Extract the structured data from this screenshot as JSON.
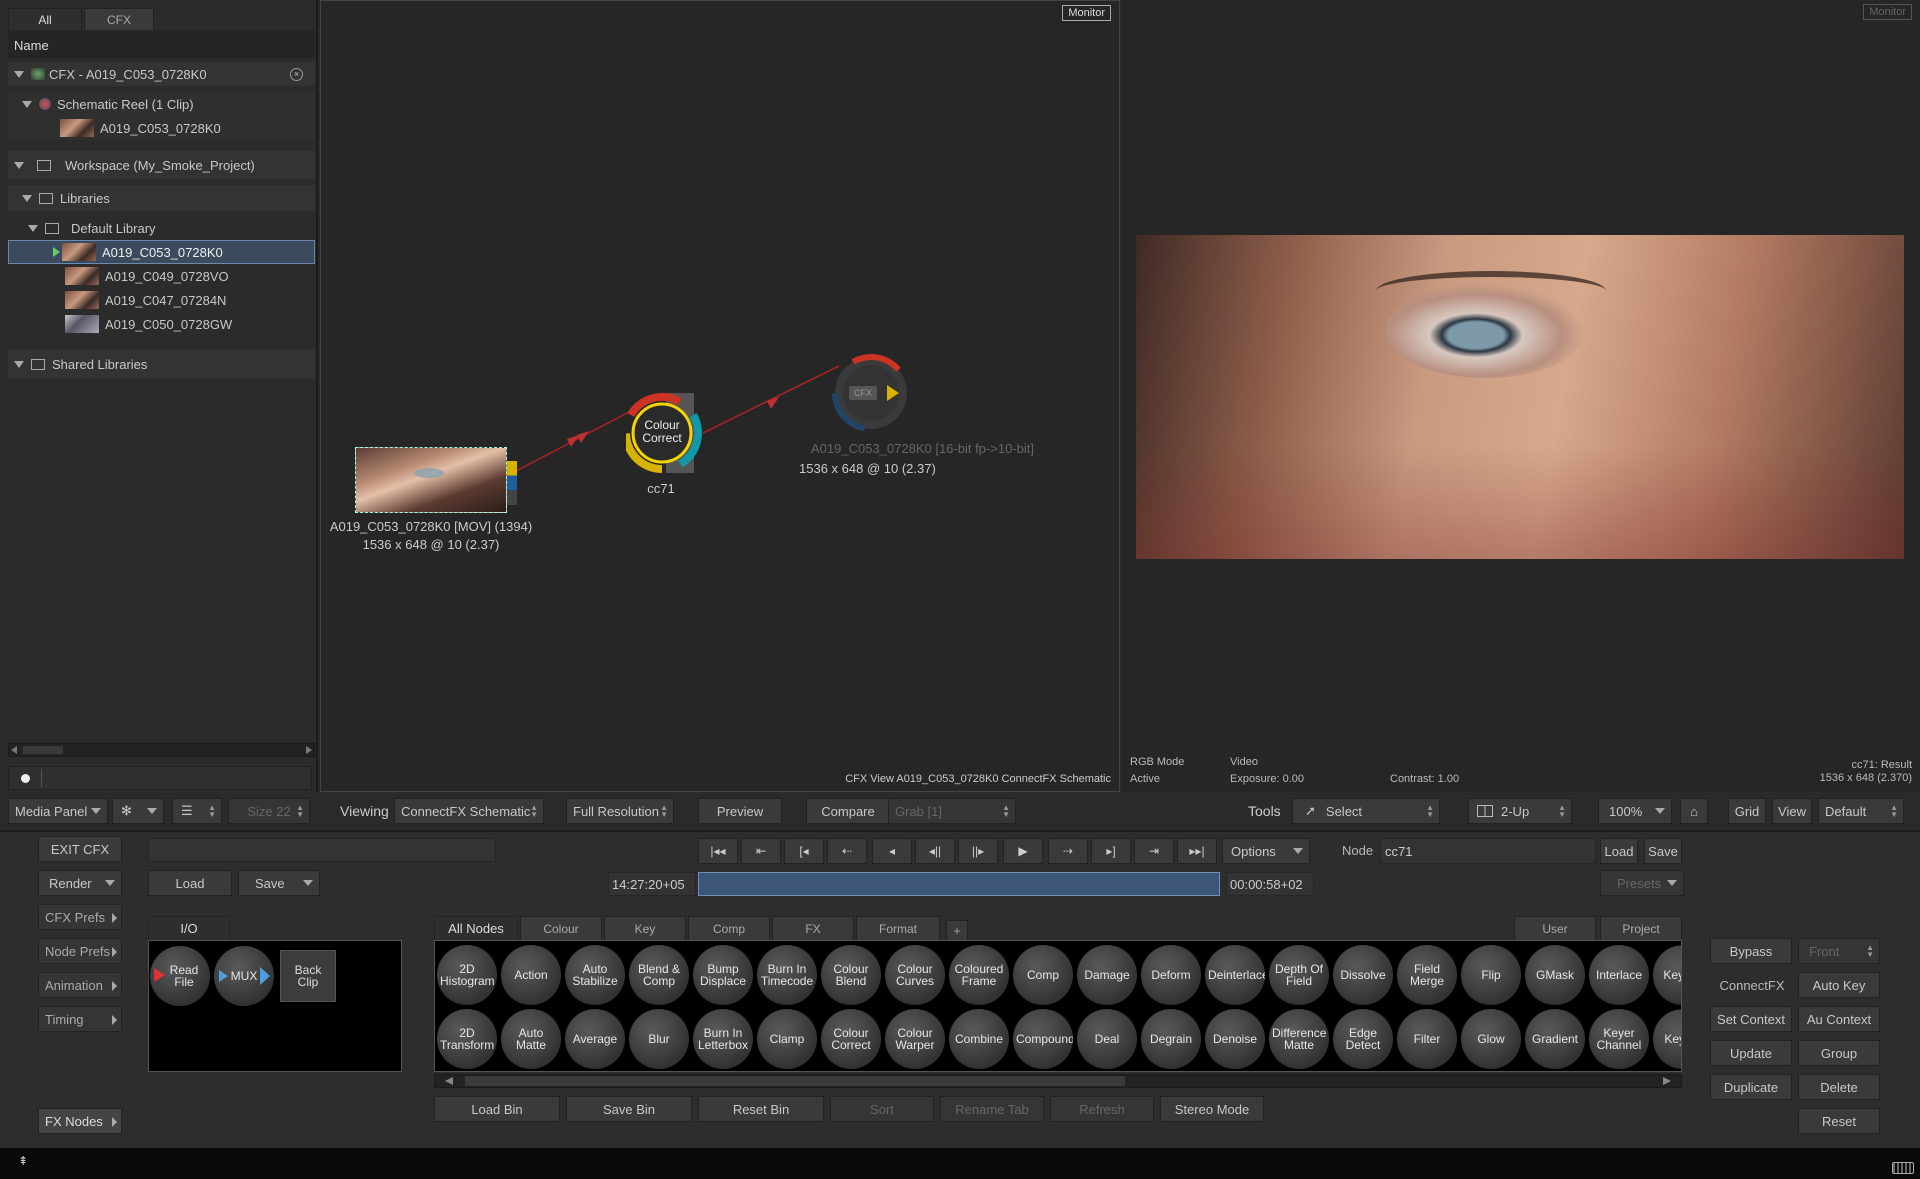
{
  "media_panel": {
    "tabs": [
      "All",
      "CFX"
    ],
    "column": "Name",
    "tree": [
      {
        "label": "CFX - A019_C053_0728K0",
        "indent": 0
      },
      {
        "label": "Schematic Reel (1 Clip)",
        "indent": 1
      },
      {
        "label": "A019_C053_0728K0",
        "indent": 2
      },
      {
        "label": "Workspace (My_Smoke_Project)",
        "indent": 0
      },
      {
        "label": "Libraries",
        "indent": 1
      },
      {
        "label": "Default Library",
        "indent": 2
      },
      {
        "label": "A019_C053_0728K0",
        "indent": 3
      },
      {
        "label": "A019_C049_0728VO",
        "indent": 3
      },
      {
        "label": "A019_C047_07284N",
        "indent": 3
      },
      {
        "label": "A019_C050_0728GW",
        "indent": 3
      },
      {
        "label": "Shared Libraries",
        "indent": 0
      }
    ],
    "footer_left": "Media Panel",
    "size_label": "Size 22"
  },
  "schematic": {
    "monitor_badge": "Monitor",
    "source_label": "A019_C053_0728K0 [MOV] (1394)",
    "source_res": "1536 x 648 @ 10 (2.37)",
    "cc_node_label": "Colour Correct",
    "cc_node_name": "cc71",
    "out_node_label": "CFX",
    "out_name": "A019_C053_0728K0 [16-bit fp->10-bit]",
    "out_res": "1536 x 648 @ 10 (2.37)",
    "footer": "CFX View A019_C053_0728K0 ConnectFX Schematic"
  },
  "viewer": {
    "monitor_badge": "Monitor",
    "rgb_mode": "RGB Mode",
    "active": "Active",
    "video": "Video",
    "exposure": "Exposure: 0.00",
    "contrast": "Contrast: 1.00",
    "result": "cc71: Result",
    "result_res": "1536 x 648 (2.370)"
  },
  "toolbar": {
    "viewing_label": "Viewing",
    "viewing_value": "ConnectFX Schematic",
    "resolution": "Full Resolution",
    "preview": "Preview",
    "compare": "Compare",
    "grab": "Grab [1]",
    "tools_label": "Tools",
    "select": "Select",
    "layout": "2-Up",
    "zoom": "100%",
    "grid": "Grid",
    "view": "View",
    "default": "Default"
  },
  "controls": {
    "exit": "EXIT CFX",
    "render": "Render",
    "load": "Load",
    "save": "Save",
    "timecode_in": "14:27:20+05",
    "timecode_out": "00:00:58+02",
    "options": "Options",
    "node_label": "Node",
    "node_value": "cc71",
    "node_load": "Load",
    "node_save": "Save",
    "presets": "Presets"
  },
  "side_menu": [
    "CFX Prefs",
    "Node Prefs",
    "Animation",
    "Timing"
  ],
  "fx_nodes_btn": "FX Nodes",
  "io": {
    "tab": "I/O",
    "nodes": [
      "Read File",
      "MUX",
      "Back Clip"
    ]
  },
  "node_bin": {
    "tabs": [
      "All Nodes",
      "Colour",
      "Key",
      "Comp",
      "FX",
      "Format",
      "+"
    ],
    "right_tabs": [
      "User",
      "Project"
    ],
    "row1": [
      "2D Histogram",
      "Action",
      "Auto Stabilize",
      "Blend & Comp",
      "Bump Displace",
      "Burn In Timecode",
      "Colour Blend",
      "Colour Curves",
      "Coloured Frame",
      "Comp",
      "Damage",
      "Deform",
      "Deinterlace",
      "Depth Of Field",
      "Dissolve",
      "Field Merge",
      "Flip",
      "GMask",
      "Interlace",
      "Key HL"
    ],
    "row2": [
      "2D Transform",
      "Auto Matte",
      "Average",
      "Blur",
      "Burn In Letterbox",
      "Clamp",
      "Colour Correct",
      "Colour Warper",
      "Combine",
      "Compound",
      "Deal",
      "Degrain",
      "Denoise",
      "Difference Matte",
      "Edge Detect",
      "Filter",
      "Glow",
      "Gradient",
      "Keyer Channel",
      "Key Lu"
    ],
    "bottom": [
      "Load Bin",
      "Save Bin",
      "Reset Bin",
      "Sort",
      "Rename Tab",
      "Refresh",
      "Stereo Mode"
    ]
  },
  "right_panel": {
    "bypass": "Bypass",
    "front": "Front",
    "connectfx": "ConnectFX",
    "auto_key": "Auto Key",
    "set_context": "Set Context",
    "au_context": "Au Context",
    "update": "Update",
    "group": "Group",
    "duplicate": "Duplicate",
    "delete": "Delete",
    "reset": "Reset"
  },
  "colors": {
    "accent": "#f5d400",
    "wire": "#c02828",
    "select": "#3b4a5c"
  }
}
